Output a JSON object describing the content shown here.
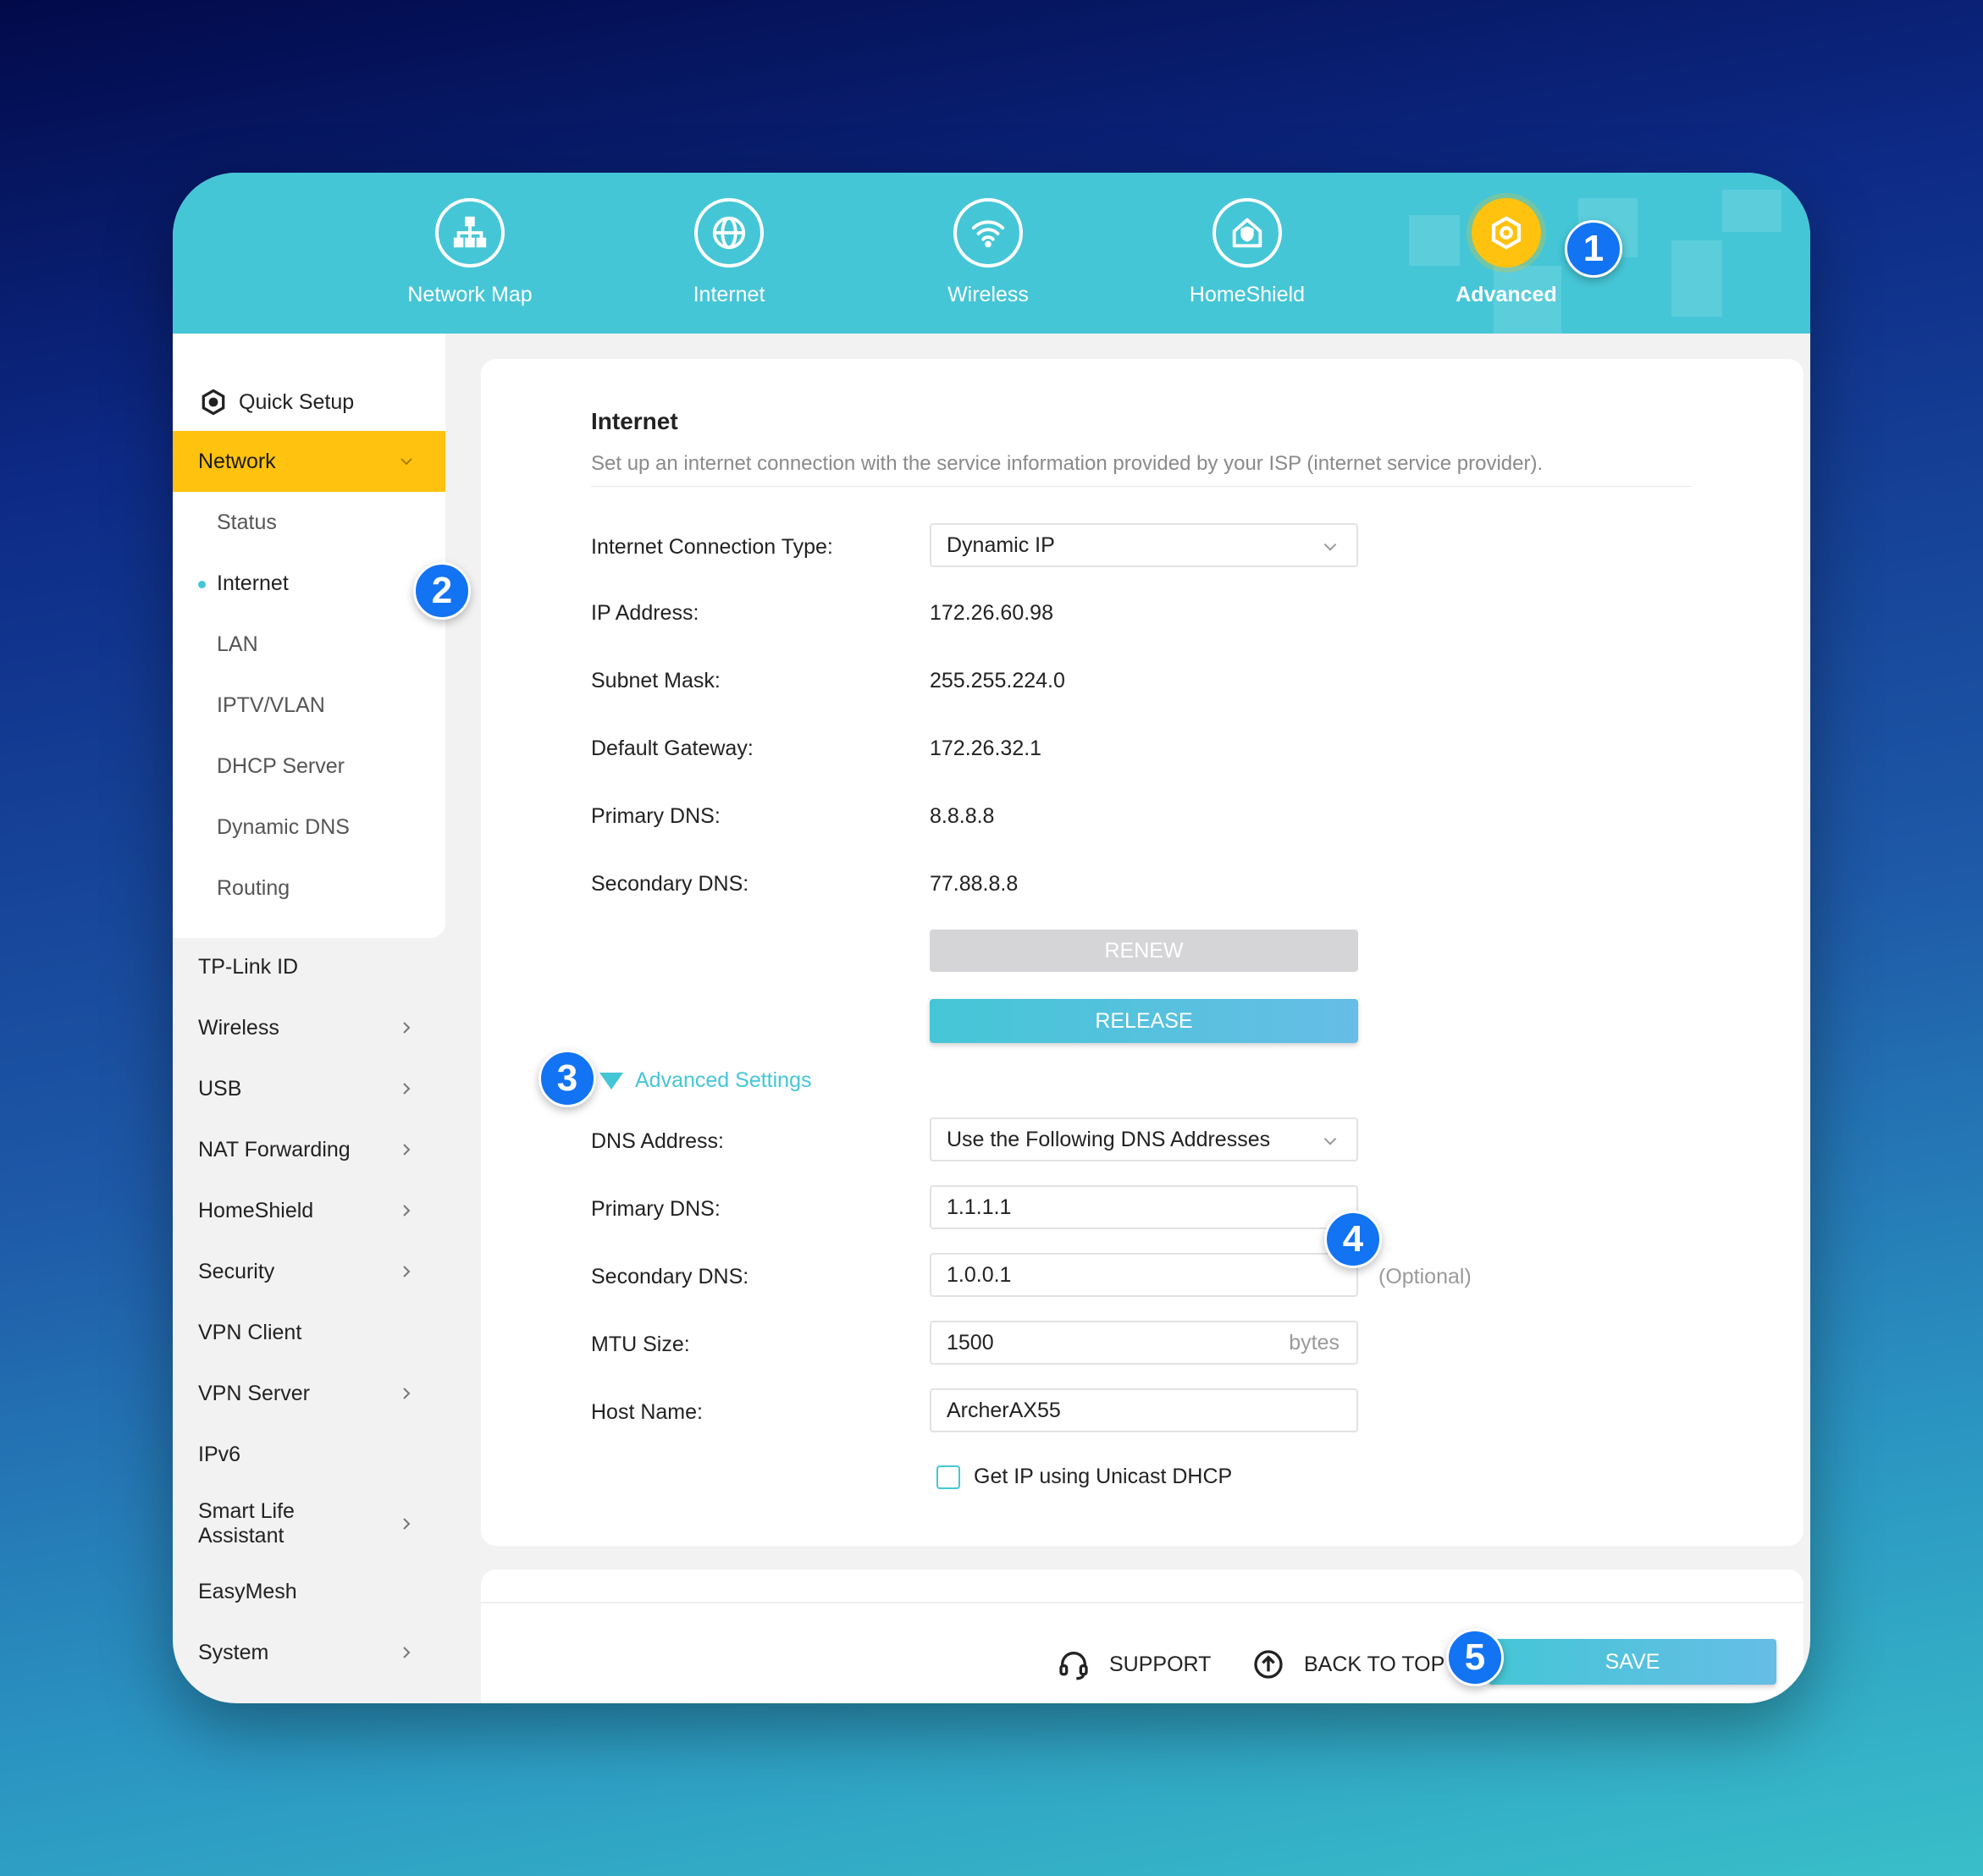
{
  "header": {
    "tabs": [
      {
        "label": "Network Map",
        "icon": "network-map-icon"
      },
      {
        "label": "Internet",
        "icon": "globe-icon"
      },
      {
        "label": "Wireless",
        "icon": "wifi-icon"
      },
      {
        "label": "HomeShield",
        "icon": "homeshield-icon"
      },
      {
        "label": "Advanced",
        "icon": "gear-icon",
        "active": true
      }
    ]
  },
  "sidebar": {
    "quick_setup": "Quick Setup",
    "network": "Network",
    "network_sub": [
      "Status",
      "Internet",
      "LAN",
      "IPTV/VLAN",
      "DHCP Server",
      "Dynamic DNS",
      "Routing"
    ],
    "items": [
      "TP-Link ID",
      "Wireless",
      "USB",
      "NAT Forwarding",
      "HomeShield",
      "Security",
      "VPN Client",
      "VPN Server",
      "IPv6",
      "Smart Life Assistant",
      "EasyMesh",
      "System"
    ]
  },
  "panel": {
    "title": "Internet",
    "description": "Set up an internet connection with the service information provided by your ISP (internet service provider).",
    "connection_type_label": "Internet Connection Type:",
    "connection_type_value": "Dynamic IP",
    "ip_label": "IP Address:",
    "ip_value": "172.26.60.98",
    "subnet_label": "Subnet Mask:",
    "subnet_value": "255.255.224.0",
    "gateway_label": "Default Gateway:",
    "gateway_value": "172.26.32.1",
    "primary_dns_label": "Primary DNS:",
    "primary_dns_value": "8.8.8.8",
    "secondary_dns_label": "Secondary DNS:",
    "secondary_dns_value": "77.88.8.8",
    "renew_label": "RENEW",
    "release_label": "RELEASE",
    "advanced_settings": "Advanced Settings",
    "dns_address_label": "DNS Address:",
    "dns_address_value": "Use the Following DNS Addresses",
    "adv_primary_dns_label": "Primary DNS:",
    "adv_primary_dns_value": "1.1.1.1",
    "adv_secondary_dns_label": "Secondary DNS:",
    "adv_secondary_dns_value": "1.0.0.1",
    "optional": "(Optional)",
    "mtu_label": "MTU Size:",
    "mtu_value": "1500",
    "mtu_unit": "bytes",
    "host_label": "Host Name:",
    "host_value": "ArcherAX55",
    "unicast_label": "Get IP using Unicast DHCP"
  },
  "footer": {
    "support": "SUPPORT",
    "back_to_top": "BACK TO TOP",
    "save": "SAVE"
  },
  "badges": [
    "1",
    "2",
    "3",
    "4",
    "5"
  ],
  "colors": {
    "accent": "#45c6d6",
    "highlight": "#ffc20e",
    "badge": "#1273f3"
  }
}
